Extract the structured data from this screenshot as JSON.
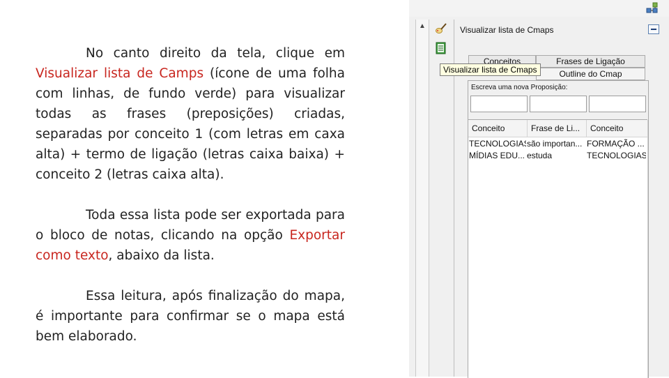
{
  "slide": {
    "p1": {
      "intro": "No canto direito da tela, clique em",
      "highlight": "Visualizar lista de Camps",
      "rest": " (ícone de uma folha com linhas, de fundo verde) para visualizar todas as frases (preposições) criadas, separadas por conceito 1 (com letras em caxa alta) + termo de ligação (letras caixa baixa) + conceito 2 (letras caixa alta)."
    },
    "p2": {
      "intro": "Toda essa lista pode ser exportada para o bloco de notas, clicando na opção ",
      "highlight": "Exportar como texto",
      "rest": ", abaixo da lista."
    },
    "p3": {
      "text": "Essa leitura, após finalização do mapa, é importante para confirmar se o mapa está bem elaborado."
    },
    "highlight_color": "#c8261f"
  },
  "panel": {
    "view_title": "Visualizar lista de Cmaps",
    "tooltip": "Visualizar lista de Cmaps",
    "tabs": {
      "conceitos": "Conceitos",
      "frases": "Frases de Ligação",
      "outline": "Outline do Cmap"
    },
    "proposition_label": "Escreva uma nova Proposição:",
    "table": {
      "headers": [
        "Conceito",
        "Frase de Li...",
        "Conceito"
      ],
      "rows": [
        [
          "TECNOLOGIAS",
          "são importan...",
          "FORMAÇÃO ..."
        ],
        [
          "MÍDIAS EDU...",
          "estuda",
          "TECNOLOGIAS"
        ]
      ]
    }
  },
  "icons": {
    "top_right": "network-icon",
    "tool_1": "pen-icon",
    "tool_2": "green-list-icon",
    "scroll_up": "chevron-up-icon",
    "minimize": "minimize-icon"
  }
}
